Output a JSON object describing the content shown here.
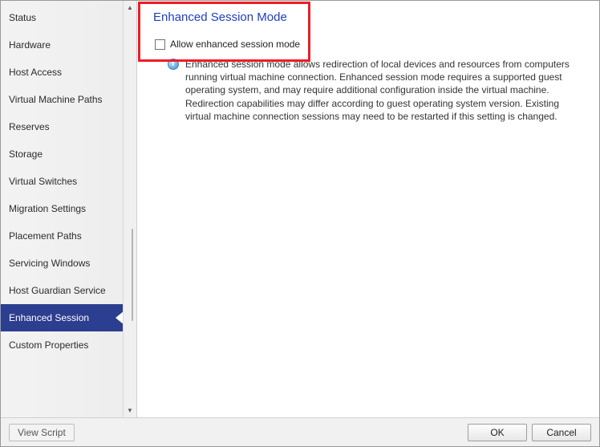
{
  "sidebar": {
    "items": [
      {
        "label": "Status"
      },
      {
        "label": "Hardware"
      },
      {
        "label": "Host Access"
      },
      {
        "label": "Virtual Machine Paths"
      },
      {
        "label": "Reserves"
      },
      {
        "label": "Storage"
      },
      {
        "label": "Virtual Switches"
      },
      {
        "label": "Migration Settings"
      },
      {
        "label": "Placement Paths"
      },
      {
        "label": "Servicing Windows"
      },
      {
        "label": "Host Guardian Service"
      },
      {
        "label": "Enhanced Session",
        "selected": true
      },
      {
        "label": "Custom Properties"
      }
    ]
  },
  "content": {
    "title": "Enhanced Session Mode",
    "checkbox_label": "Allow enhanced session mode",
    "info_text": "Enhanced session mode allows redirection of local devices and resources from computers running virtual machine connection. Enhanced session mode requires a supported guest operating system, and may require additional configuration inside the virtual machine. Redirection capabilities may differ according to guest operating system version. Existing virtual machine connection sessions may need to be restarted if this setting is changed."
  },
  "footer": {
    "view_script": "View Script",
    "ok": "OK",
    "cancel": "Cancel"
  }
}
